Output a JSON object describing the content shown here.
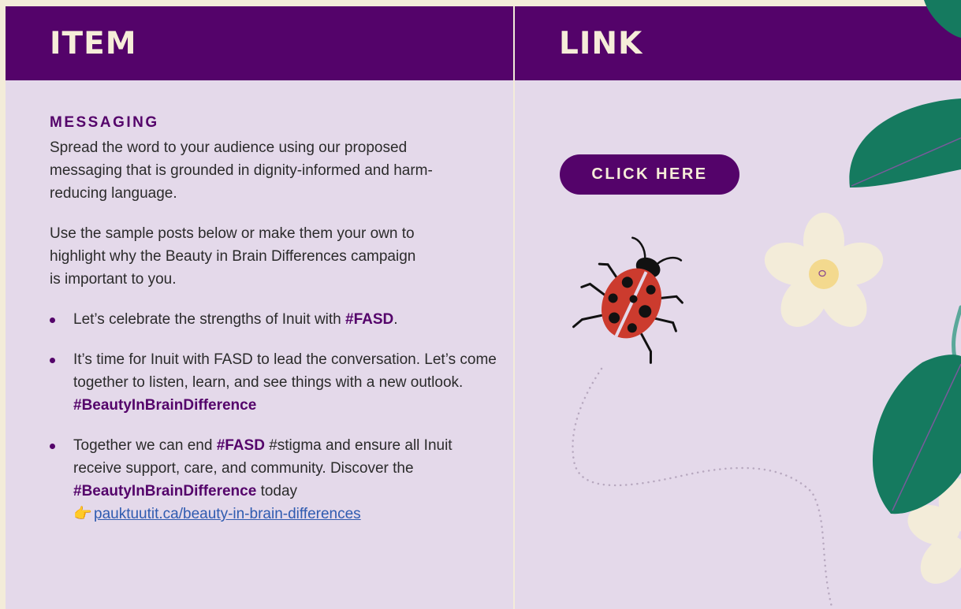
{
  "table": {
    "header_item": "ITEM",
    "header_link": "LINK"
  },
  "messaging": {
    "title": "MESSAGING",
    "intro": "Spread the word to your audience using our proposed messaging that is grounded in dignity-informed and harm-reducing language.",
    "instruction": "Use the sample posts below or make them your own to highlight why the Beauty in Brain Differences campaign is important to you.",
    "posts": [
      {
        "text_a": "Let’s celebrate the strengths of Inuit with ",
        "tag_a": "#FASD",
        "text_b": "."
      },
      {
        "text_a": "It’s time for Inuit with FASD to lead the conversation. Let’s come together to listen, learn, and see things with a new outlook. ",
        "tag_a": "#BeautyInBrainDifference"
      },
      {
        "text_a": "Together we can end ",
        "tag_a": "#FASD",
        "text_b": " #stigma and ensure all Inuit receive support, care, and community. Discover the ",
        "tag_b": "#BeautyInBrainDifference",
        "text_c": " today",
        "emoji": "👉",
        "link": "pauktuutit.ca/beauty-in-brain-differences"
      }
    ]
  },
  "cta": {
    "label": "CLICK HERE"
  },
  "colors": {
    "header_bg": "#54036a",
    "panel_bg": "#e4d9ea",
    "cream": "#f3ecd9",
    "leaf": "#157a5f",
    "ladybug": "#cc3b2e"
  },
  "icons": [
    "pointing-hand-icon",
    "ladybug-icon",
    "flower-icon",
    "leaf-icon"
  ]
}
